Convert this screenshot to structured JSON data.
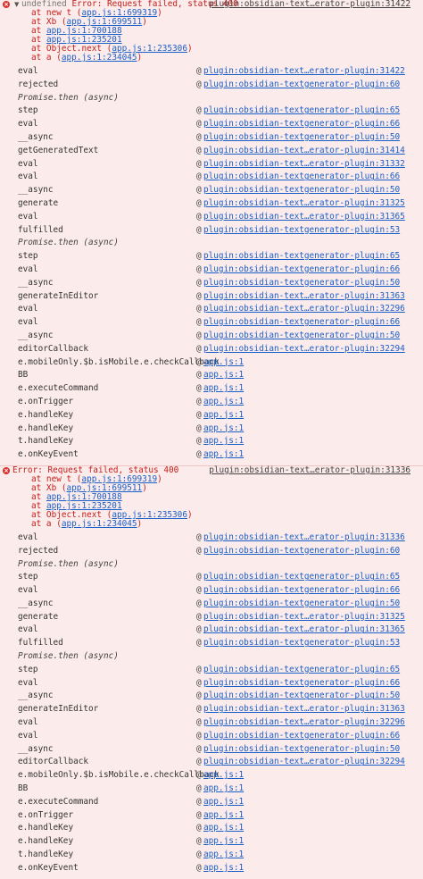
{
  "errors": [
    {
      "prefix": "undefined",
      "message": "Error: Request failed, status 400",
      "source": "plugin:obsidian-text…erator-plugin:31422",
      "collapsed_arrow": "▼",
      "stack": [
        {
          "pre": "at new t (",
          "link": "app.js:1:699319",
          "post": ")"
        },
        {
          "pre": "at Xb (",
          "link": "app.js:1:699511",
          "post": ")"
        },
        {
          "pre": "at ",
          "link": "app.js:1:700188",
          "post": ""
        },
        {
          "pre": "at ",
          "link": "app.js:1:235201",
          "post": ""
        },
        {
          "pre": "at Object.next (",
          "link": "app.js:1:235306",
          "post": ")"
        },
        {
          "pre": "at a (",
          "link": "app.js:1:234045",
          "post": ")"
        }
      ],
      "frames": [
        {
          "fn": "eval",
          "src": "plugin:obsidian-text…erator-plugin:31422"
        },
        {
          "fn": "rejected",
          "src": "plugin:obsidian-textgenerator-plugin:60"
        },
        {
          "fn": "Promise.then (async)",
          "async": true
        },
        {
          "fn": "step",
          "src": "plugin:obsidian-textgenerator-plugin:65"
        },
        {
          "fn": "eval",
          "src": "plugin:obsidian-textgenerator-plugin:66"
        },
        {
          "fn": "__async",
          "src": "plugin:obsidian-textgenerator-plugin:50"
        },
        {
          "fn": "getGeneratedText",
          "src": "plugin:obsidian-text…erator-plugin:31414"
        },
        {
          "fn": "eval",
          "src": "plugin:obsidian-text…erator-plugin:31332"
        },
        {
          "fn": "eval",
          "src": "plugin:obsidian-textgenerator-plugin:66"
        },
        {
          "fn": "__async",
          "src": "plugin:obsidian-textgenerator-plugin:50"
        },
        {
          "fn": "generate",
          "src": "plugin:obsidian-text…erator-plugin:31325"
        },
        {
          "fn": "eval",
          "src": "plugin:obsidian-text…erator-plugin:31365"
        },
        {
          "fn": "fulfilled",
          "src": "plugin:obsidian-textgenerator-plugin:53"
        },
        {
          "fn": "Promise.then (async)",
          "async": true
        },
        {
          "fn": "step",
          "src": "plugin:obsidian-textgenerator-plugin:65"
        },
        {
          "fn": "eval",
          "src": "plugin:obsidian-textgenerator-plugin:66"
        },
        {
          "fn": "__async",
          "src": "plugin:obsidian-textgenerator-plugin:50"
        },
        {
          "fn": "generateInEditor",
          "src": "plugin:obsidian-text…erator-plugin:31363"
        },
        {
          "fn": "eval",
          "src": "plugin:obsidian-text…erator-plugin:32296"
        },
        {
          "fn": "eval",
          "src": "plugin:obsidian-textgenerator-plugin:66"
        },
        {
          "fn": "__async",
          "src": "plugin:obsidian-textgenerator-plugin:50"
        },
        {
          "fn": "editorCallback",
          "src": "plugin:obsidian-text…erator-plugin:32294"
        },
        {
          "fn": "e.mobileOnly.$b.isMobile.e.checkCallback",
          "src": "app.js:1"
        },
        {
          "fn": "BB",
          "src": "app.js:1"
        },
        {
          "fn": "e.executeCommand",
          "src": "app.js:1"
        },
        {
          "fn": "e.onTrigger",
          "src": "app.js:1"
        },
        {
          "fn": "e.handleKey",
          "src": "app.js:1"
        },
        {
          "fn": "e.handleKey",
          "src": "app.js:1"
        },
        {
          "fn": "t.handleKey",
          "src": "app.js:1"
        },
        {
          "fn": "e.onKeyEvent",
          "src": "app.js:1"
        }
      ]
    },
    {
      "prefix": "",
      "message": "Error: Request failed, status 400",
      "source": "plugin:obsidian-text…erator-plugin:31336",
      "collapsed_arrow": "",
      "stack": [
        {
          "pre": "at new t (",
          "link": "app.js:1:699319",
          "post": ")"
        },
        {
          "pre": "at Xb (",
          "link": "app.js:1:699511",
          "post": ")"
        },
        {
          "pre": "at ",
          "link": "app.js:1:700188",
          "post": ""
        },
        {
          "pre": "at ",
          "link": "app.js:1:235201",
          "post": ""
        },
        {
          "pre": "at Object.next (",
          "link": "app.js:1:235306",
          "post": ")"
        },
        {
          "pre": "at a (",
          "link": "app.js:1:234045",
          "post": ")"
        }
      ],
      "frames": [
        {
          "fn": "eval",
          "src": "plugin:obsidian-text…erator-plugin:31336"
        },
        {
          "fn": "rejected",
          "src": "plugin:obsidian-textgenerator-plugin:60"
        },
        {
          "fn": "Promise.then (async)",
          "async": true
        },
        {
          "fn": "step",
          "src": "plugin:obsidian-textgenerator-plugin:65"
        },
        {
          "fn": "eval",
          "src": "plugin:obsidian-textgenerator-plugin:66"
        },
        {
          "fn": "__async",
          "src": "plugin:obsidian-textgenerator-plugin:50"
        },
        {
          "fn": "generate",
          "src": "plugin:obsidian-text…erator-plugin:31325"
        },
        {
          "fn": "eval",
          "src": "plugin:obsidian-text…erator-plugin:31365"
        },
        {
          "fn": "fulfilled",
          "src": "plugin:obsidian-textgenerator-plugin:53"
        },
        {
          "fn": "Promise.then (async)",
          "async": true
        },
        {
          "fn": "step",
          "src": "plugin:obsidian-textgenerator-plugin:65"
        },
        {
          "fn": "eval",
          "src": "plugin:obsidian-textgenerator-plugin:66"
        },
        {
          "fn": "__async",
          "src": "plugin:obsidian-textgenerator-plugin:50"
        },
        {
          "fn": "generateInEditor",
          "src": "plugin:obsidian-text…erator-plugin:31363"
        },
        {
          "fn": "eval",
          "src": "plugin:obsidian-text…erator-plugin:32296"
        },
        {
          "fn": "eval",
          "src": "plugin:obsidian-textgenerator-plugin:66"
        },
        {
          "fn": "__async",
          "src": "plugin:obsidian-textgenerator-plugin:50"
        },
        {
          "fn": "editorCallback",
          "src": "plugin:obsidian-text…erator-plugin:32294"
        },
        {
          "fn": "e.mobileOnly.$b.isMobile.e.checkCallback",
          "src": "app.js:1"
        },
        {
          "fn": "BB",
          "src": "app.js:1"
        },
        {
          "fn": "e.executeCommand",
          "src": "app.js:1"
        },
        {
          "fn": "e.onTrigger",
          "src": "app.js:1"
        },
        {
          "fn": "e.handleKey",
          "src": "app.js:1"
        },
        {
          "fn": "e.handleKey",
          "src": "app.js:1"
        },
        {
          "fn": "t.handleKey",
          "src": "app.js:1"
        },
        {
          "fn": "e.onKeyEvent",
          "src": "app.js:1"
        }
      ]
    }
  ],
  "at_symbol": "@",
  "icons": {
    "error": "error-circle-icon",
    "toggle": "disclosure-triangle-icon"
  },
  "colors": {
    "background": "#fcebeb",
    "error_text": "#c0201b",
    "link": "#1a5fc7",
    "error_icon": "#d9302c"
  }
}
